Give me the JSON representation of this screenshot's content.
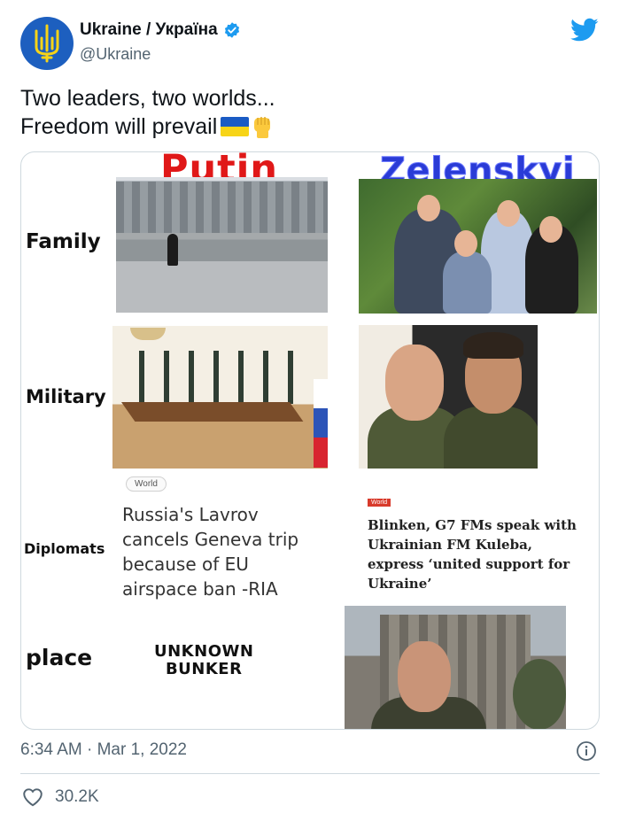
{
  "author": {
    "display_name": "Ukraine / Україна",
    "handle": "@Ukraine",
    "verified": true,
    "avatar_icon": "trident-icon"
  },
  "tweet": {
    "line1": "Two leaders, two worlds...",
    "line2": "Freedom will prevail",
    "emojis": [
      "ukraine-flag-emoji",
      "raised-fist-emoji"
    ]
  },
  "image": {
    "col_left": "Putin",
    "col_right": "Zelenskyi",
    "rows": {
      "family": "Family",
      "military": "Military",
      "diplomats": "Diplomats",
      "place": "place"
    },
    "news_left": {
      "tag": "World",
      "headline": "Russia's Lavrov cancels Geneva trip because of EU airspace ban -RIA"
    },
    "news_right": {
      "tag": "World",
      "headline": "Blinken, G7 FMs speak with Ukrainian FM Kuleba, express ‘united support for Ukraine’"
    },
    "bunker_line1": "UNKNOWN",
    "bunker_line2": "BUNKER"
  },
  "footer": {
    "timestamp": "6:34 AM · Mar 1, 2022",
    "likes": "30.2K"
  },
  "colors": {
    "twitter_blue": "#1d9bf0",
    "text_secondary": "#536471",
    "putin_red": "#e01818",
    "zelenskyi_blue": "#2a3bd6"
  }
}
